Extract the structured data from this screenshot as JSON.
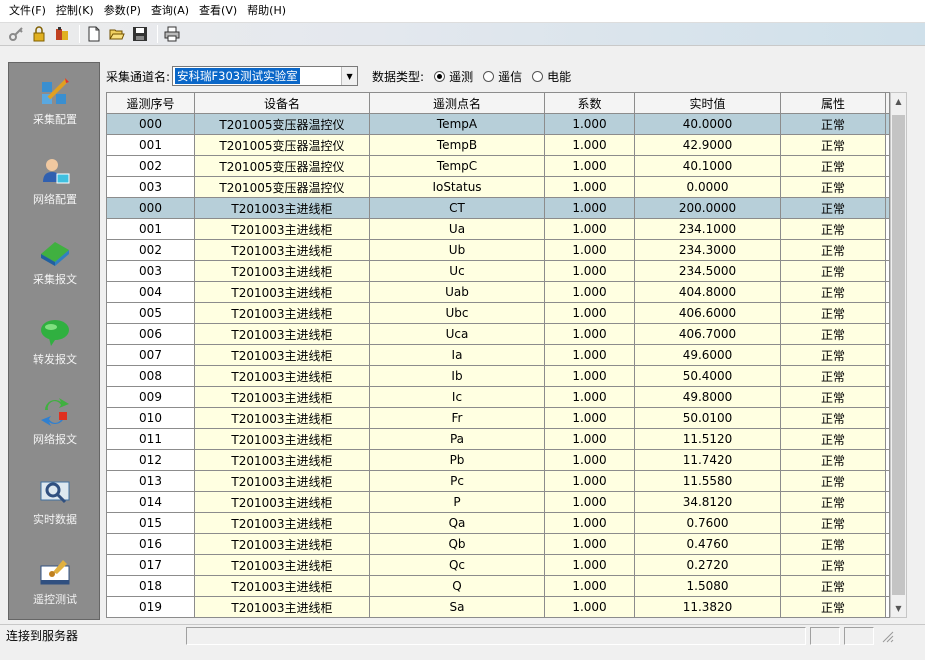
{
  "menu": [
    "文件(F)",
    "控制(K)",
    "参数(P)",
    "查询(A)",
    "查看(V)",
    "帮助(H)"
  ],
  "toolbar": {
    "icons": [
      "key-icon",
      "lock-icon",
      "users-icon",
      "new-file-icon",
      "open-folder-icon",
      "save-icon",
      "print-icon"
    ]
  },
  "sidebar": {
    "items": [
      {
        "label": "采集配置",
        "icon": "config-icon"
      },
      {
        "label": "网络配置",
        "icon": "network-config-icon"
      },
      {
        "label": "采集报文",
        "icon": "capture-message-icon"
      },
      {
        "label": "转发报文",
        "icon": "forward-message-icon"
      },
      {
        "label": "网络报文",
        "icon": "network-message-icon"
      },
      {
        "label": "实时数据",
        "icon": "realtime-data-icon"
      },
      {
        "label": "遥控测试",
        "icon": "remote-control-icon"
      }
    ]
  },
  "filter": {
    "channel_label": "采集通道名:",
    "channel_value": "安科瑞F303测试实验室",
    "type_label": "数据类型:",
    "types": [
      "遥测",
      "遥信",
      "电能"
    ],
    "selected_type": "遥测"
  },
  "table": {
    "columns": [
      "遥测序号",
      "设备名",
      "遥测点名",
      "系数",
      "实时值",
      "属性"
    ],
    "rows": [
      [
        "000",
        "T201005变压器温控仪",
        "TempA",
        "1.000",
        "40.0000",
        "正常"
      ],
      [
        "001",
        "T201005变压器温控仪",
        "TempB",
        "1.000",
        "42.9000",
        "正常"
      ],
      [
        "002",
        "T201005变压器温控仪",
        "TempC",
        "1.000",
        "40.1000",
        "正常"
      ],
      [
        "003",
        "T201005变压器温控仪",
        "IoStatus",
        "1.000",
        "0.0000",
        "正常"
      ],
      [
        "000",
        "T201003主进线柜",
        "CT",
        "1.000",
        "200.0000",
        "正常"
      ],
      [
        "001",
        "T201003主进线柜",
        "Ua",
        "1.000",
        "234.1000",
        "正常"
      ],
      [
        "002",
        "T201003主进线柜",
        "Ub",
        "1.000",
        "234.3000",
        "正常"
      ],
      [
        "003",
        "T201003主进线柜",
        "Uc",
        "1.000",
        "234.5000",
        "正常"
      ],
      [
        "004",
        "T201003主进线柜",
        "Uab",
        "1.000",
        "404.8000",
        "正常"
      ],
      [
        "005",
        "T201003主进线柜",
        "Ubc",
        "1.000",
        "406.6000",
        "正常"
      ],
      [
        "006",
        "T201003主进线柜",
        "Uca",
        "1.000",
        "406.7000",
        "正常"
      ],
      [
        "007",
        "T201003主进线柜",
        "Ia",
        "1.000",
        "49.6000",
        "正常"
      ],
      [
        "008",
        "T201003主进线柜",
        "Ib",
        "1.000",
        "50.4000",
        "正常"
      ],
      [
        "009",
        "T201003主进线柜",
        "Ic",
        "1.000",
        "49.8000",
        "正常"
      ],
      [
        "010",
        "T201003主进线柜",
        "Fr",
        "1.000",
        "50.0100",
        "正常"
      ],
      [
        "011",
        "T201003主进线柜",
        "Pa",
        "1.000",
        "11.5120",
        "正常"
      ],
      [
        "012",
        "T201003主进线柜",
        "Pb",
        "1.000",
        "11.7420",
        "正常"
      ],
      [
        "013",
        "T201003主进线柜",
        "Pc",
        "1.000",
        "11.5580",
        "正常"
      ],
      [
        "014",
        "T201003主进线柜",
        "P",
        "1.000",
        "34.8120",
        "正常"
      ],
      [
        "015",
        "T201003主进线柜",
        "Qa",
        "1.000",
        "0.7600",
        "正常"
      ],
      [
        "016",
        "T201003主进线柜",
        "Qb",
        "1.000",
        "0.4760",
        "正常"
      ],
      [
        "017",
        "T201003主进线柜",
        "Qc",
        "1.000",
        "0.2720",
        "正常"
      ],
      [
        "018",
        "T201003主进线柜",
        "Q",
        "1.000",
        "1.5080",
        "正常"
      ],
      [
        "019",
        "T201003主进线柜",
        "Sa",
        "1.000",
        "11.3820",
        "正常"
      ]
    ],
    "highlighted_rows": [
      0,
      4
    ]
  },
  "status": {
    "text": "连接到服务器"
  },
  "colors": {
    "row_yellow": "#ffffe1",
    "row_highlight": "#b7cfd9",
    "sidebar_bg": "#8c8c8c",
    "selection_blue": "#0a67c8"
  }
}
